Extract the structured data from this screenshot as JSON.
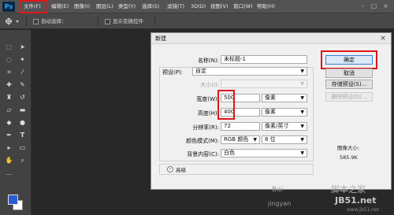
{
  "app": {
    "logo": "Ps"
  },
  "menu": [
    "文件(F)",
    "编辑(E)",
    "图像(I)",
    "图层(L)",
    "类型(Y)",
    "选择(S)",
    "滤镜(T)",
    "3D(D)",
    "视图(V)",
    "窗口(W)",
    "帮助(H)"
  ],
  "window_controls": [
    "–",
    "□",
    "×"
  ],
  "options_bar": {
    "auto_select_label": "自动选择：",
    "show_transform_label": "显示变换控件"
  },
  "dialog": {
    "title": "新建",
    "close": "×",
    "name_label": "名称(N):",
    "name_value": "未标题-1",
    "preset_label": "预设(P):",
    "preset_value": "自定",
    "size_label": "大小(I):",
    "width_label": "宽度(W):",
    "width_value": "500",
    "width_unit": "像素",
    "height_label": "高度(H):",
    "height_value": "400",
    "height_unit": "像素",
    "resolution_label": "分辨率(R):",
    "resolution_value": "72",
    "resolution_unit": "像素/英寸",
    "color_mode_label": "颜色模式(M):",
    "color_mode_value": "RGB 颜色",
    "bit_depth_value": "8 位",
    "background_label": "背景内容(C):",
    "background_value": "白色",
    "advanced_label": "高级",
    "buttons": {
      "ok": "确定",
      "cancel": "取消",
      "save_preset": "存储预设(S)...",
      "delete_preset": "删除预设(D)..."
    },
    "image_size_label": "图像大小:",
    "image_size_value": "585.9K"
  },
  "watermarks": {
    "baidu": "Bai",
    "jingyan": "jingyan",
    "site1": "脚本之家",
    "site2": "JB51.net",
    "site3": "www.jb51.net"
  },
  "colors": {
    "highlight": "#e0161c",
    "foreground_swatch": "#2b5bd6",
    "background_swatch": "#ffffff"
  }
}
